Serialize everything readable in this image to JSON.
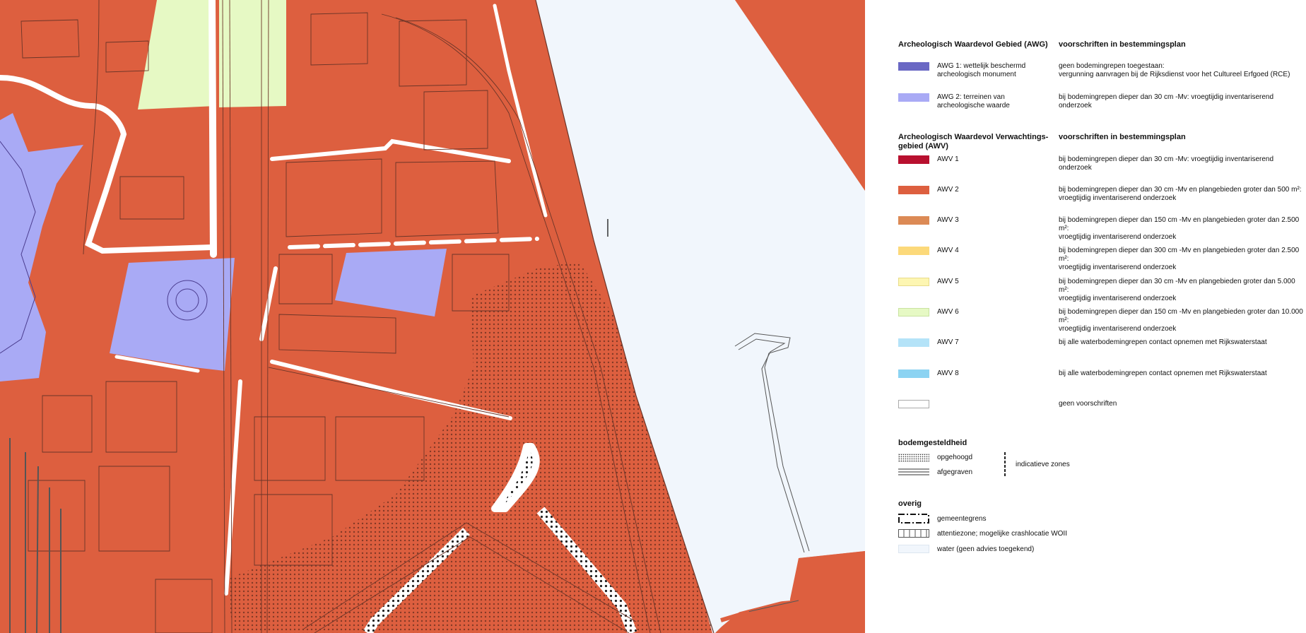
{
  "colors": {
    "awv2": "#dd5f3f",
    "awg1": "#6a68c4",
    "awg2": "#a9aaf5",
    "awv1": "#b8102f",
    "awv3": "#dc8a55",
    "awv4": "#fcd97a",
    "awv5": "#fdf6b2",
    "awv6": "#e6f9c4",
    "awv7": "#b4e3f8",
    "awv8": "#8cd3f2",
    "water": "#f1f6fc",
    "line": "#5a2a1e",
    "white": "#ffffff"
  },
  "legend": {
    "awg_title": "Archeologisch Waardevol Gebied (AWG)",
    "awg_rules_title": "voorschriften in bestemmingsplan",
    "awg_items": [
      {
        "label": "AWG 1: wettelijk beschermd\narcheologisch monument",
        "rule": "geen bodemingrepen toegestaan:\nvergunning aanvragen bij de Rijksdienst voor het Cultureel Erfgoed (RCE)",
        "color_key": "awg1"
      },
      {
        "label": "AWG 2: terreinen van\narcheologische waarde",
        "rule": "bij bodemingrepen dieper dan 30 cm -Mv: vroegtijdig inventariserend onderzoek",
        "color_key": "awg2"
      }
    ],
    "awv_title": "Archeologisch Waardevol Verwachtings-\ngebied (AWV)",
    "awv_rules_title": "voorschriften in bestemmingsplan",
    "awv_items": [
      {
        "label": "AWV 1",
        "rule": "bij bodemingrepen dieper dan 30 cm -Mv: vroegtijdig inventariserend onderzoek",
        "color_key": "awv1"
      },
      {
        "label": "AWV 2",
        "rule": "bij bodemingrepen dieper dan 30 cm -Mv en plangebieden groter dan 500 m²:\nvroegtijdig inventariserend onderzoek",
        "color_key": "awv2"
      },
      {
        "label": "AWV 3",
        "rule": "bij bodemingrepen dieper dan 150 cm -Mv en plangebieden groter dan 2.500 m²:\nvroegtijdig inventariserend onderzoek",
        "color_key": "awv3"
      },
      {
        "label": "AWV 4",
        "rule": "bij bodemingrepen dieper dan 300 cm -Mv en plangebieden groter dan 2.500 m²:\nvroegtijdig inventariserend onderzoek",
        "color_key": "awv4"
      },
      {
        "label": "AWV 5",
        "rule": "bij bodemingrepen dieper dan 30 cm -Mv en plangebieden groter dan 5.000 m²:\nvroegtijdig inventariserend onderzoek",
        "color_key": "awv5"
      },
      {
        "label": "AWV 6",
        "rule": "bij bodemingrepen dieper dan 150 cm -Mv en plangebieden groter dan 10.000 m²:\nvroegtijdig inventariserend onderzoek",
        "color_key": "awv6"
      },
      {
        "label": "AWV 7",
        "rule": "bij alle waterbodemingrepen contact opnemen met Rijkswaterstaat",
        "color_key": "awv7"
      },
      {
        "label": "AWV 8",
        "rule": "bij alle waterbodemingrepen contact opnemen met Rijkswaterstaat",
        "color_key": "awv8"
      },
      {
        "label": "",
        "rule": "geen voorschriften",
        "color_key": "white"
      }
    ],
    "bodem_title": "bodemgesteldheid",
    "bodem_items": [
      {
        "label": "opgehoogd",
        "symbol": "dotted-pattern"
      },
      {
        "label": "afgegraven",
        "symbol": "triple-lines"
      }
    ],
    "indicative_label": "indicatieve zones",
    "overig_title": "overig",
    "overig_items": [
      {
        "label": "gemeentegrens",
        "symbol": "dash-dot-border"
      },
      {
        "label": "attentiezone; mogelijke crashlocatie WOII",
        "symbol": "vertical-hatch"
      },
      {
        "label": "water (geen advies toegekend)",
        "symbol": "water-box"
      }
    ]
  }
}
